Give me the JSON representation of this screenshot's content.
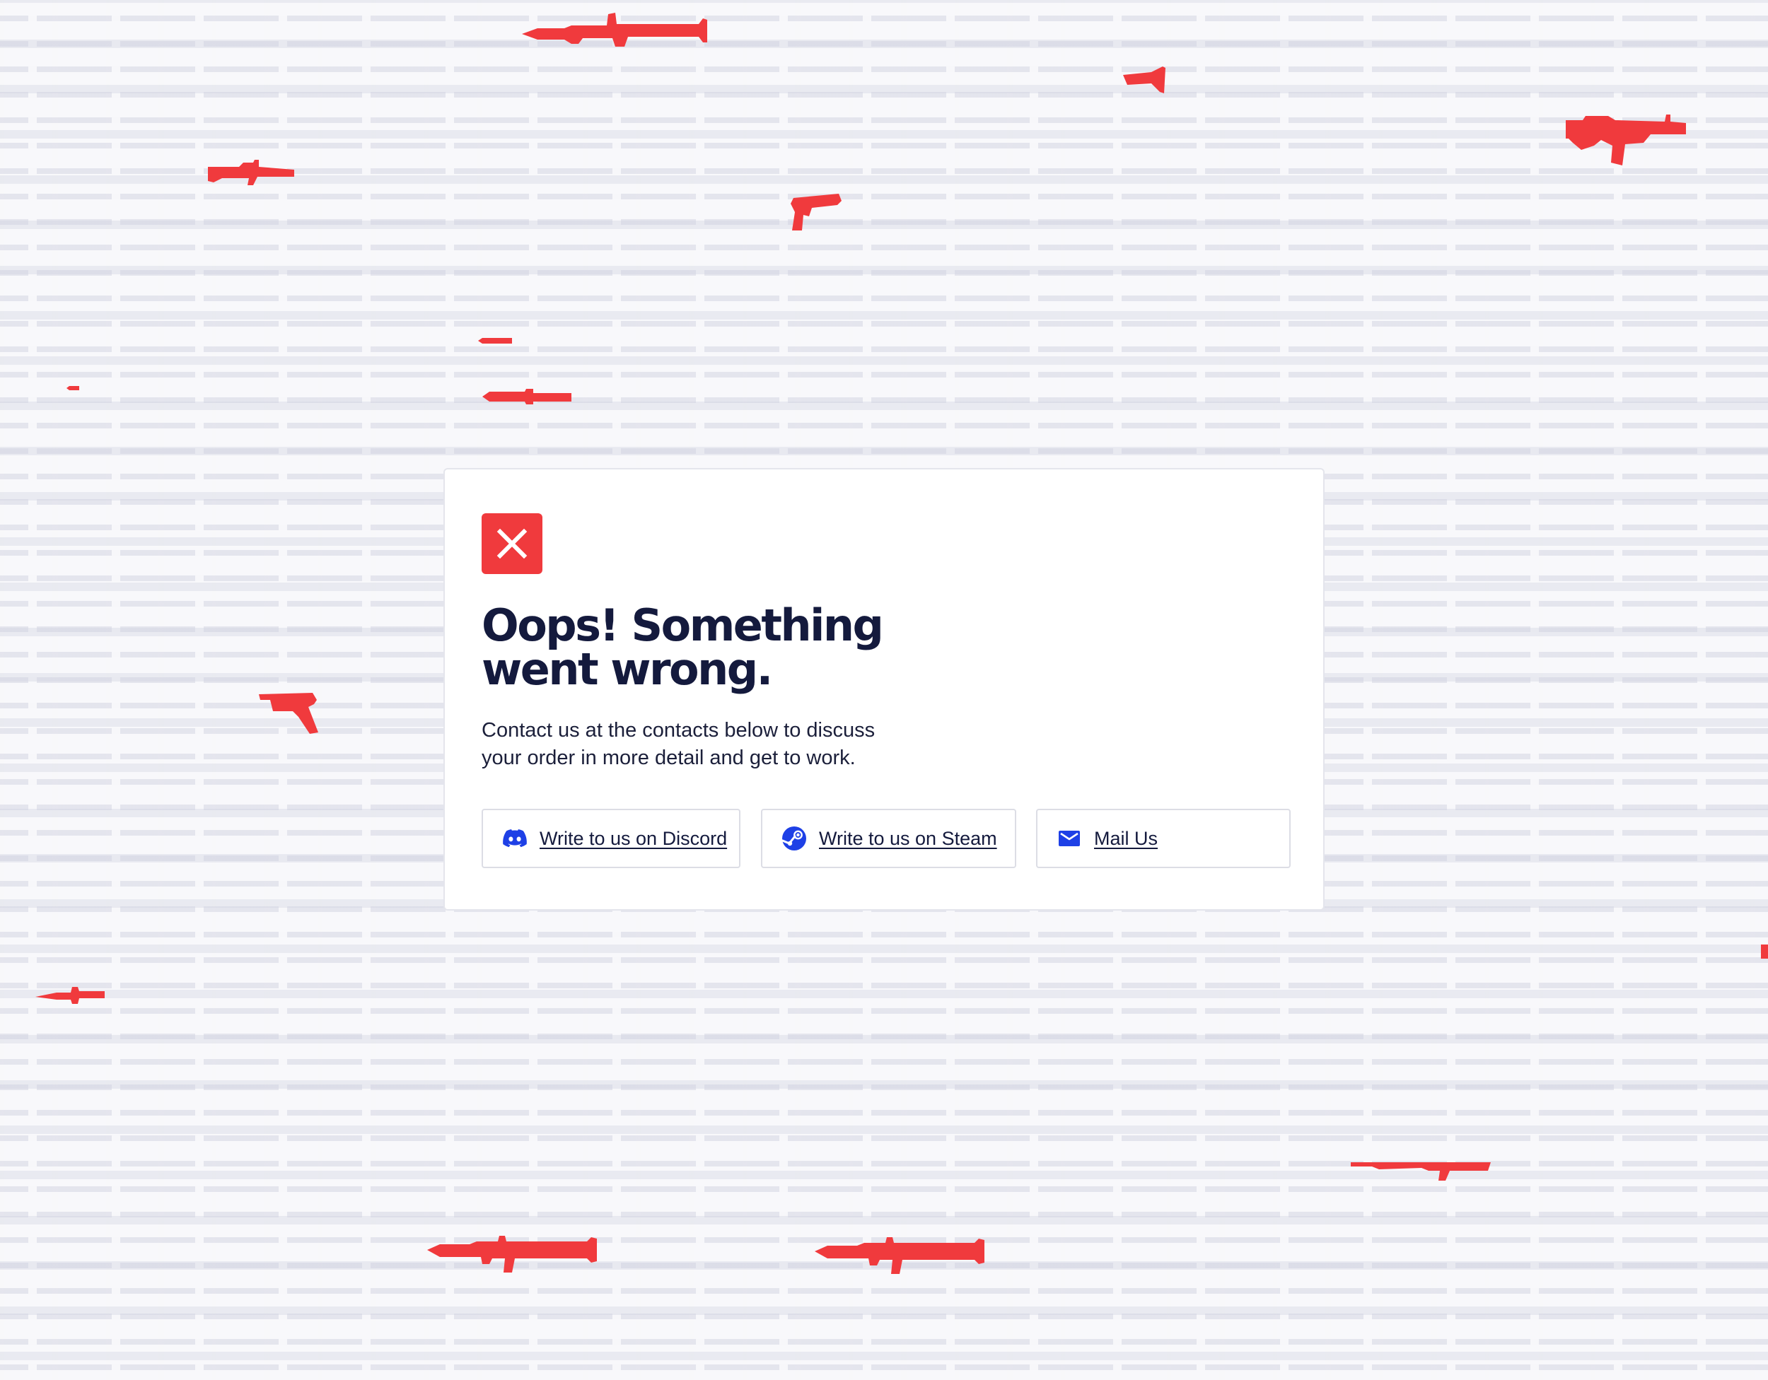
{
  "dialog": {
    "title": "Oops! Something went wrong.",
    "message": "Contact us at the contacts below to discuss your order in more detail and get to work.",
    "status_icon": "close-icon",
    "accent_color": "#f03a3d"
  },
  "contacts": {
    "discord_label": "Write to us on Discord",
    "steam_label": "Write to us on Steam",
    "mail_label": "Mail Us",
    "icon_color": "#1e40e6"
  },
  "background": {
    "pattern": "weapon silhouettes",
    "highlight_color": "#f03a3d"
  }
}
